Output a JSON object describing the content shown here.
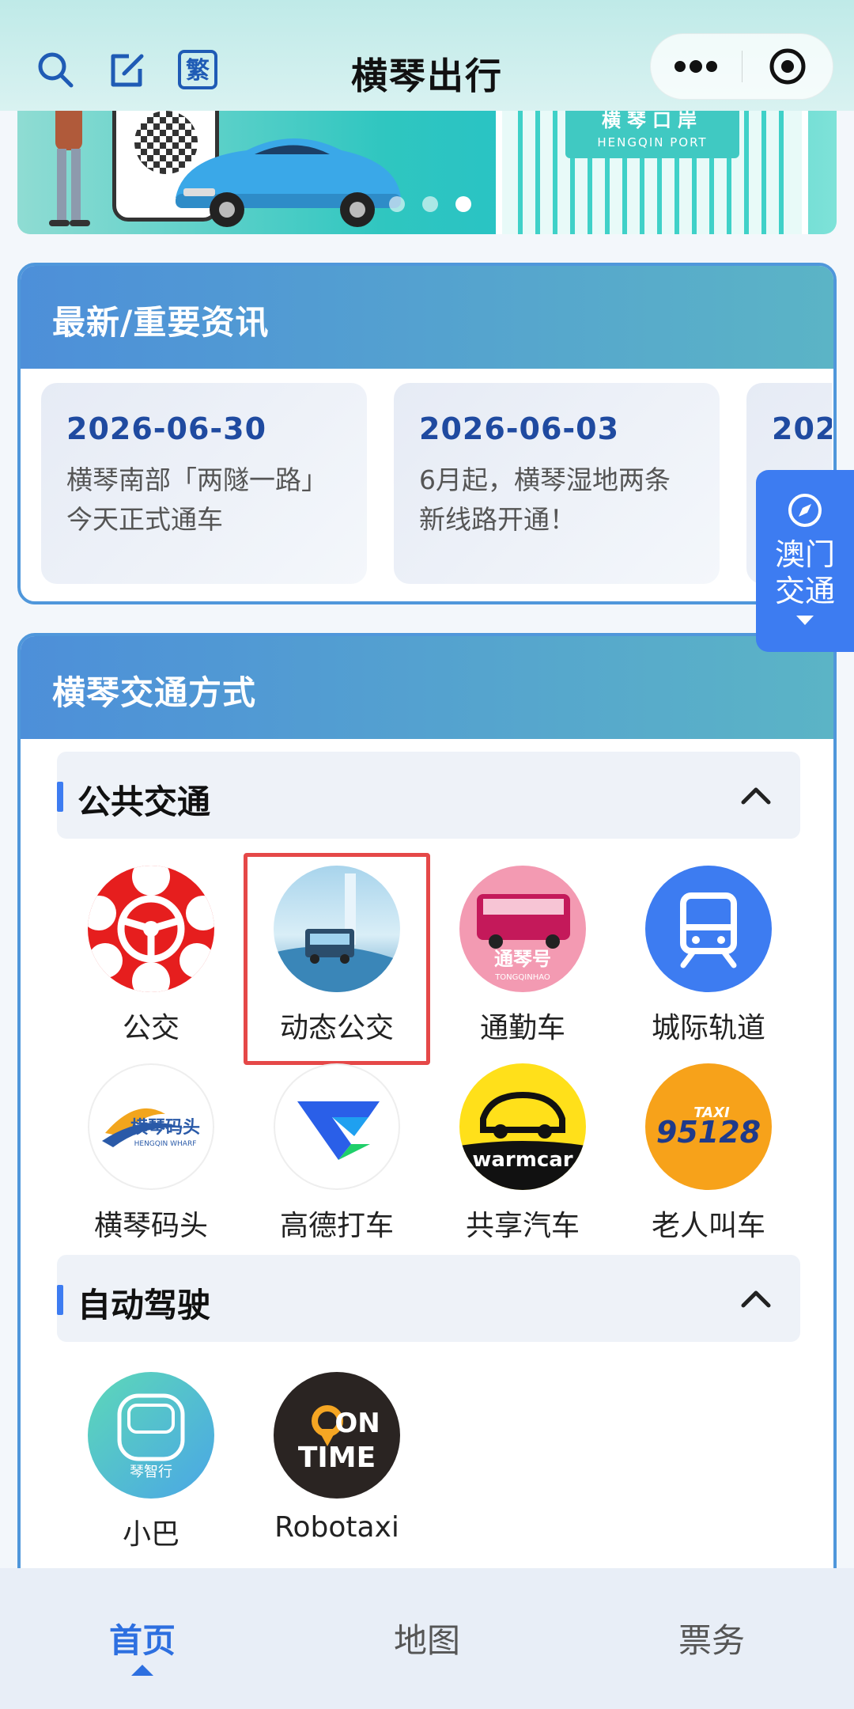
{
  "header": {
    "title": "横琴出行",
    "icons": [
      "search-icon",
      "edit-icon",
      "traditional-chinese-icon"
    ],
    "traditional_label": "繁",
    "capsule_icons": [
      "more-icon",
      "close-target-icon"
    ]
  },
  "banner": {
    "port_name_cn": "横琴口岸",
    "port_name_en": "HENGQIN PORT",
    "slide_count": 3,
    "active_slide": 3
  },
  "news": {
    "title": "最新/重要资讯",
    "items": [
      {
        "date": "2026-06-30",
        "text": "横琴南部「两隧一路」今天正式通车"
      },
      {
        "date": "2026-06-03",
        "text": "6月起，横琴湿地两条新线路开通！"
      },
      {
        "date": "202",
        "text": ""
      }
    ]
  },
  "macau_float": {
    "label": "澳门交通"
  },
  "transport": {
    "title": "横琴交通方式",
    "public": {
      "title": "公共交通",
      "items": [
        {
          "label": "公交"
        },
        {
          "label": "动态公交"
        },
        {
          "label": "通勤车",
          "badge": "通琴号",
          "badge_en": "TONGQINHAO"
        },
        {
          "label": "城际轨道"
        },
        {
          "label": "横琴码头",
          "logo_text": "横琴码头",
          "logo_en": "HENGQIN WHARF"
        },
        {
          "label": "高德打车"
        },
        {
          "label": "共享汽车",
          "logo_text": "warmcar"
        },
        {
          "label": "老人叫车",
          "logo_top": "TAXI",
          "logo_num": "95128"
        }
      ]
    },
    "autonomous": {
      "title": "自动驾驶",
      "items": [
        {
          "label": "小巴",
          "logo_text": "琴智行"
        },
        {
          "label": "Robotaxi",
          "logo_top": "ON",
          "logo_bottom": "TIME"
        }
      ]
    }
  },
  "tabbar": {
    "tabs": [
      {
        "label": "首页",
        "active": true
      },
      {
        "label": "地图",
        "active": false
      },
      {
        "label": "票务",
        "active": false
      }
    ]
  },
  "colors": {
    "accent": "#3d7cf1",
    "header_gradient_start": "#4d8fd9",
    "header_gradient_end": "#5bb4c6",
    "highlight": "#e54848",
    "news_date": "#1f4aa0"
  }
}
